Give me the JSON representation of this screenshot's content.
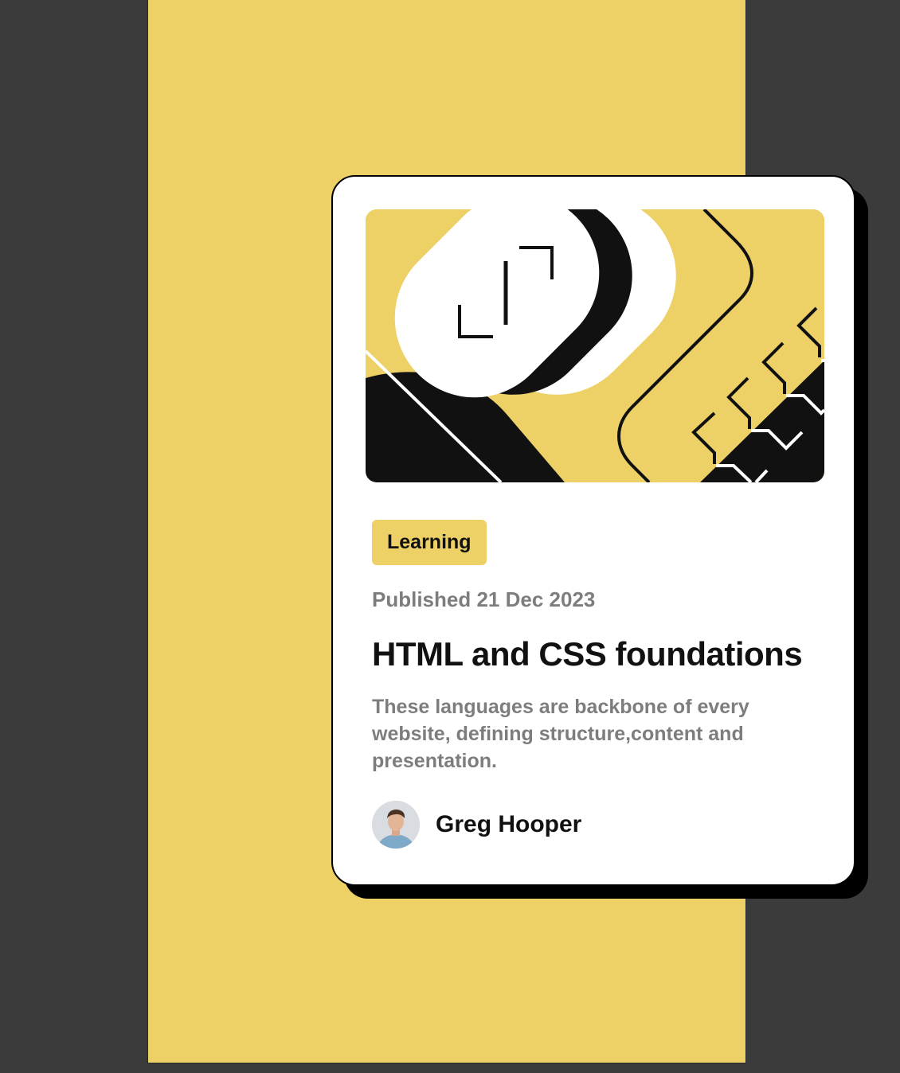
{
  "card": {
    "category": "Learning",
    "published": "Published 21 Dec 2023",
    "title": "HTML and CSS foundations",
    "description": "These languages are backbone of every website, defining structure,content and presentation.",
    "author": {
      "name": "Greg Hooper"
    },
    "illustration": "abstract-html-css-illustration"
  },
  "colors": {
    "background": "#edd166",
    "card": "#ffffff",
    "shadow": "#000000",
    "text_primary": "#111111",
    "text_secondary": "#7d7d7d"
  }
}
